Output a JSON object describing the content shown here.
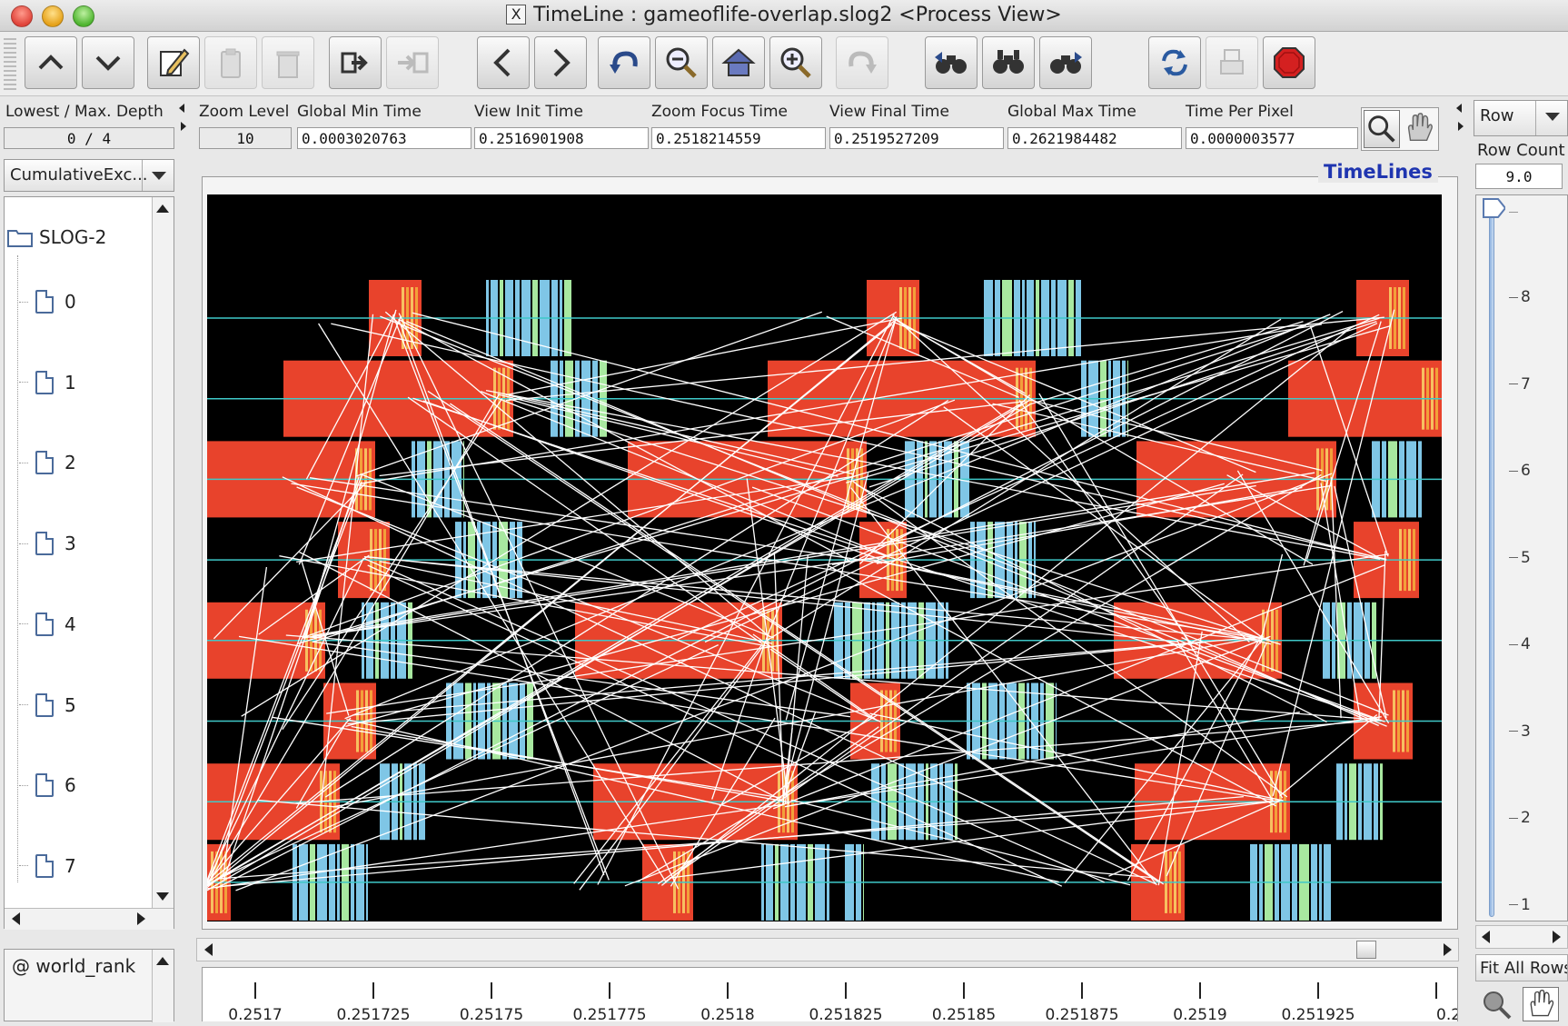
{
  "window": {
    "title": "TimeLine : gameoflife-overlap.slog2  <Process View>"
  },
  "toolbar": {
    "buttons": [
      {
        "name": "up-icon",
        "enabled": true
      },
      {
        "name": "down-icon",
        "enabled": true
      },
      {
        "name": "edit-icon",
        "enabled": true
      },
      {
        "name": "paste-icon",
        "enabled": false
      },
      {
        "name": "delete-icon",
        "enabled": false
      },
      {
        "name": "export-icon",
        "enabled": true
      },
      {
        "name": "import-icon",
        "enabled": false
      },
      {
        "name": "scroll-left-icon",
        "enabled": true
      },
      {
        "name": "scroll-right-icon",
        "enabled": true
      },
      {
        "name": "undo-icon",
        "enabled": true
      },
      {
        "name": "zoom-out-icon",
        "enabled": true
      },
      {
        "name": "home-icon",
        "enabled": true
      },
      {
        "name": "zoom-in-icon",
        "enabled": true
      },
      {
        "name": "redo-icon",
        "enabled": false
      },
      {
        "name": "search-backward-icon",
        "enabled": true
      },
      {
        "name": "search-init-icon",
        "enabled": true
      },
      {
        "name": "search-forward-icon",
        "enabled": true
      },
      {
        "name": "refresh-icon",
        "enabled": true
      },
      {
        "name": "print-icon",
        "enabled": false
      },
      {
        "name": "stop-icon",
        "enabled": true
      }
    ]
  },
  "info": {
    "depth_label": "Lowest / Max. Depth",
    "depth_value": "0 / 4",
    "zoom_level_label": "Zoom Level",
    "zoom_level_value": "10",
    "global_min_label": "Global Min Time",
    "global_min_value": "0.0003020763",
    "view_init_label": "View  Init Time",
    "view_init_value": "0.2516901908",
    "zoom_focus_label": "Zoom Focus Time",
    "zoom_focus_value": "0.2518214559",
    "view_final_label": "View Final Time",
    "view_final_value": "0.2519527209",
    "global_max_label": "Global Max Time",
    "global_max_value": "0.2621984482",
    "time_per_pixel_label": "Time Per Pixel",
    "time_per_pixel_value": "0.0000003577"
  },
  "left_panel": {
    "combo_value": "CumulativeExc...",
    "root_label": "SLOG-2",
    "ranks": [
      "0",
      "1",
      "2",
      "3",
      "4",
      "5",
      "6",
      "7"
    ],
    "bottom_label": "@ world_rank"
  },
  "right_panel": {
    "row_combo": "Row",
    "row_count_label": "Row Count",
    "row_count_value": "9.0",
    "ruler_ticks": [
      "8",
      "7",
      "6",
      "5",
      "4",
      "3",
      "2",
      "1"
    ],
    "fit_button": "Fit All Rows"
  },
  "timeline": {
    "title": "TimeLines",
    "colors": {
      "background": "#000000",
      "compute": "#e8432c",
      "compute_edge": "#f2a13a",
      "comm_blue": "#7fc6e6",
      "comm_green": "#a8e8a0",
      "guide": "#3fc8c8",
      "arrow": "#ffffff"
    },
    "axis_ticks": [
      "0.2517",
      "0.251725",
      "0.25175",
      "0.251775",
      "0.2518",
      "0.251825",
      "0.25185",
      "0.251875",
      "0.2519",
      "0.251925",
      "0.2"
    ]
  }
}
